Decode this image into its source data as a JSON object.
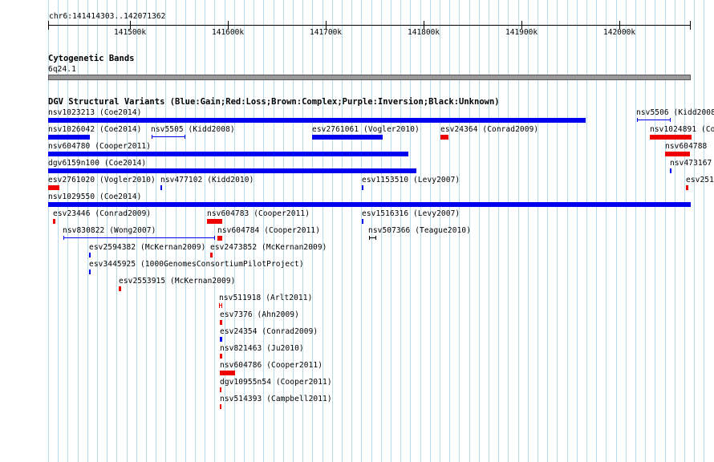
{
  "position": "chr6:141414303..142071362",
  "ruler": {
    "labels": [
      "141500k",
      "141600k",
      "141700k",
      "141800k",
      "141900k",
      "142000k"
    ]
  },
  "cytobands": {
    "title": "Cytogenetic Bands",
    "band": "6q24.1"
  },
  "dgv": {
    "title": "DGV Structural Variants (Blue:Gain;Red:Loss;Brown:Complex;Purple:Inversion;Black:Unknown)",
    "colors": {
      "gain": "#0000ee",
      "loss": "#ee0000",
      "unknown": "#000000"
    },
    "labels": {
      "nsv1023213": "nsv1023213 (Coe2014)",
      "nsv5506": "nsv5506 (Kidd2008",
      "nsv1026042": "nsv1026042 (Coe2014)",
      "nsv5505": "nsv5505 (Kidd2008)",
      "esv2761061": "esv2761061 (Vogler2010)",
      "esv24364": "esv24364 (Conrad2009)",
      "nsv1024891": "nsv1024891 (Co",
      "nsv604780": "nsv604780 (Cooper2011)",
      "nsv604788": "nsv604788",
      "dgv6159n100": "dgv6159n100 (Coe2014)",
      "nsv473167": "nsv473167",
      "esv2761020": "esv2761020 (Vogler2010)",
      "nsv477102": "nsv477102 (Kidd2010)",
      "esv1153510": "esv1153510 (Levy2007)",
      "esv251": "esv251",
      "nsv1029550": "nsv1029550 (Coe2014)",
      "esv23446": "esv23446 (Conrad2009)",
      "nsv604783": "nsv604783 (Cooper2011)",
      "esv1516316": "esv1516316 (Levy2007)",
      "nsv830822": "nsv830822 (Wong2007)",
      "nsv604784": "nsv604784 (Cooper2011)",
      "nsv507366": "nsv507366 (Teague2010)",
      "esv2594382": "esv2594382 (McKernan2009)",
      "esv2473852": "esv2473852 (McKernan2009)",
      "esv3445925": "esv3445925 (1000GenomesConsortiumPilotProject)",
      "esv2553915": "esv2553915 (McKernan2009)",
      "nsv511918": "nsv511918 (Arlt2011)",
      "esv7376": "esv7376 (Ahn2009)",
      "esv24354": "esv24354 (Conrad2009)",
      "nsv821463": "nsv821463 (Ju2010)",
      "nsv604786": "nsv604786 (Cooper2011)",
      "dgv10955n54": "dgv10955n54 (Cooper2011)",
      "nsv514393": "nsv514393 (Campbell2011)"
    }
  }
}
